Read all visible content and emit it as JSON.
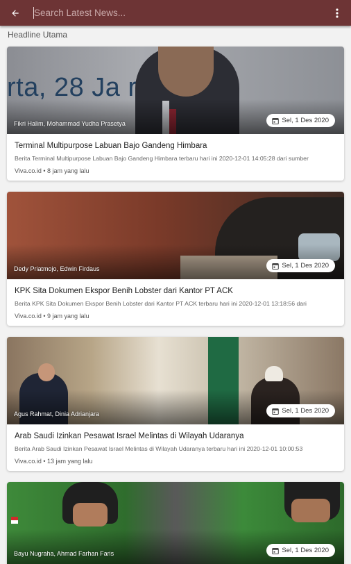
{
  "search": {
    "placeholder": "Search Latest News..."
  },
  "section": {
    "title": "Headline Utama"
  },
  "icons": {
    "back": "arrow-left-icon",
    "menu": "more-vertical-icon",
    "date": "calendar-icon"
  },
  "colors": {
    "appbar": "#6d3435"
  },
  "articles": [
    {
      "credit": "Fikri Halim, Mohammad Yudha Prasetya",
      "date": "Sel, 1 Des 2020",
      "title": "Terminal Multipurpose Labuan Bajo Gandeng Himbara",
      "summary": "Berita Terminal Multipurpose Labuan Bajo Gandeng Himbara terbaru hari ini 2020-12-01 14:05:28 dari sumber",
      "source": "Viva.co.id",
      "time": "8 jam yang lalu",
      "backdrop_text": "rta, 28 Ja    ri 2019"
    },
    {
      "credit": "Dedy Priatmojo, Edwin Firdaus",
      "date": "Sel, 1 Des 2020",
      "title": "KPK Sita Dokumen Ekspor Benih Lobster dari Kantor PT ACK",
      "summary": "Berita KPK Sita Dokumen Ekspor Benih Lobster dari Kantor PT ACK terbaru hari ini 2020-12-01 13:18:56 dari",
      "source": "Viva.co.id",
      "time": "9 jam yang lalu"
    },
    {
      "credit": "Agus Rahmat, Dinia Adrianjara",
      "date": "Sel, 1 Des 2020",
      "title": "Arab Saudi Izinkan Pesawat Israel Melintas di Wilayah Udaranya",
      "summary": "Berita Arab Saudi Izinkan Pesawat Israel Melintas di Wilayah Udaranya terbaru hari ini 2020-12-01 10:00:53",
      "source": "Viva.co.id",
      "time": "13 jam yang lalu"
    },
    {
      "credit": "Bayu Nugraha, Ahmad Farhan Faris",
      "date": "Sel, 1 Des 2020"
    }
  ]
}
